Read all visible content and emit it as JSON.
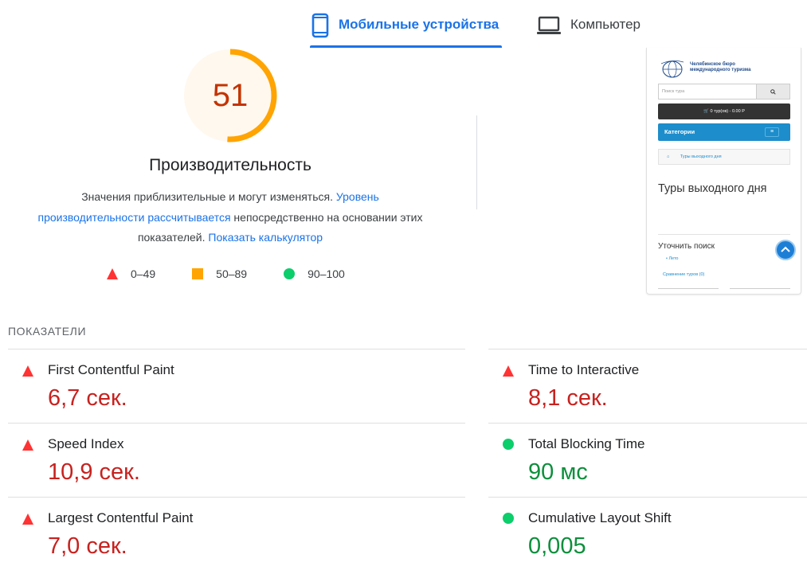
{
  "tabs": {
    "mobile": "Мобильные устройства",
    "desktop": "Компьютер"
  },
  "score": {
    "value": "51",
    "fraction": 0.51,
    "title": "Производительность",
    "color": "#ffa400"
  },
  "description": {
    "text1": "Значения приблизительные и могут изменяться. ",
    "link1": "Уровень производительности рассчитывается",
    "text2": " непосредственно на основании этих показателей. ",
    "link2": "Показать калькулятор"
  },
  "legend": [
    {
      "label": "0–49",
      "shape": "triangle-red"
    },
    {
      "label": "50–89",
      "shape": "square-orange"
    },
    {
      "label": "90–100",
      "shape": "circle-green"
    }
  ],
  "preview": {
    "brand": "Челябинское бюро международного туризма",
    "search_placeholder": "Поиск тура",
    "search_icon": "search-icon",
    "cart": "0 тур(ов) - 0.00 Р",
    "categories": "Категории",
    "menu_icon": "≡",
    "breadcrumb": "Туры выходного дня",
    "heading": "Туры выходного дня",
    "refine": "Уточнить поиск",
    "summer": "Лето",
    "compare": "Сравнение туров (0)"
  },
  "metrics": {
    "heading": "ПОКАЗАТЕЛИ",
    "items": [
      {
        "name": "First Contentful Paint",
        "value": "6,7 сек.",
        "status": "red"
      },
      {
        "name": "Time to Interactive",
        "value": "8,1 сек.",
        "status": "red"
      },
      {
        "name": "Speed Index",
        "value": "10,9 сек.",
        "status": "red"
      },
      {
        "name": "Total Blocking Time",
        "value": "90 мс",
        "status": "green"
      },
      {
        "name": "Largest Contentful Paint",
        "value": "7,0 сек.",
        "status": "red"
      },
      {
        "name": "Cumulative Layout Shift",
        "value": "0,005",
        "status": "green"
      }
    ]
  }
}
